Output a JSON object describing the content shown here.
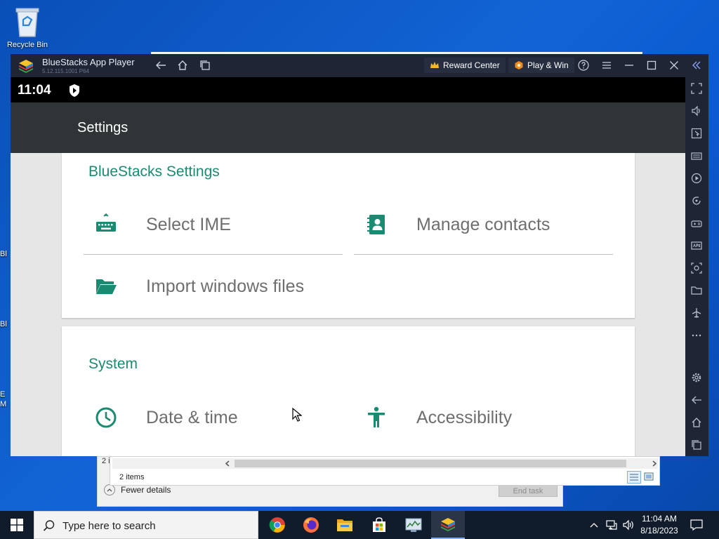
{
  "desktop": {
    "recycle_bin_label": "Recycle Bin",
    "left_labels": [
      "Bl",
      "Bl",
      "E",
      "M"
    ]
  },
  "window": {
    "app_name": "BlueStacks App Player",
    "version": "5.12.115.1001 P64",
    "reward_center": "Reward Center",
    "play_win": "Play & Win"
  },
  "android": {
    "clock": "11:04"
  },
  "settings": {
    "header_title": "Settings",
    "sections": [
      {
        "title": "BlueStacks Settings",
        "items": [
          {
            "label": "Select IME",
            "icon": "keyboard-icon"
          },
          {
            "label": "Manage contacts",
            "icon": "contacts-icon"
          },
          {
            "label": "Import windows files",
            "icon": "folder-open-icon"
          }
        ]
      },
      {
        "title": "System",
        "items": [
          {
            "label": "Date & time",
            "icon": "clock-icon"
          },
          {
            "label": "Accessibility",
            "icon": "accessibility-icon"
          }
        ]
      }
    ]
  },
  "explorer": {
    "items_count": "2 items",
    "hidden_text": "2 it"
  },
  "task_manager": {
    "fewer_details": "Fewer details",
    "end_task": "End task"
  },
  "taskbar": {
    "search_placeholder": "Type here to search",
    "time": "11:04 AM",
    "date": "8/18/2023"
  },
  "colors": {
    "accent_green": "#1a8b70",
    "bluestacks_frame": "#1f2535"
  }
}
